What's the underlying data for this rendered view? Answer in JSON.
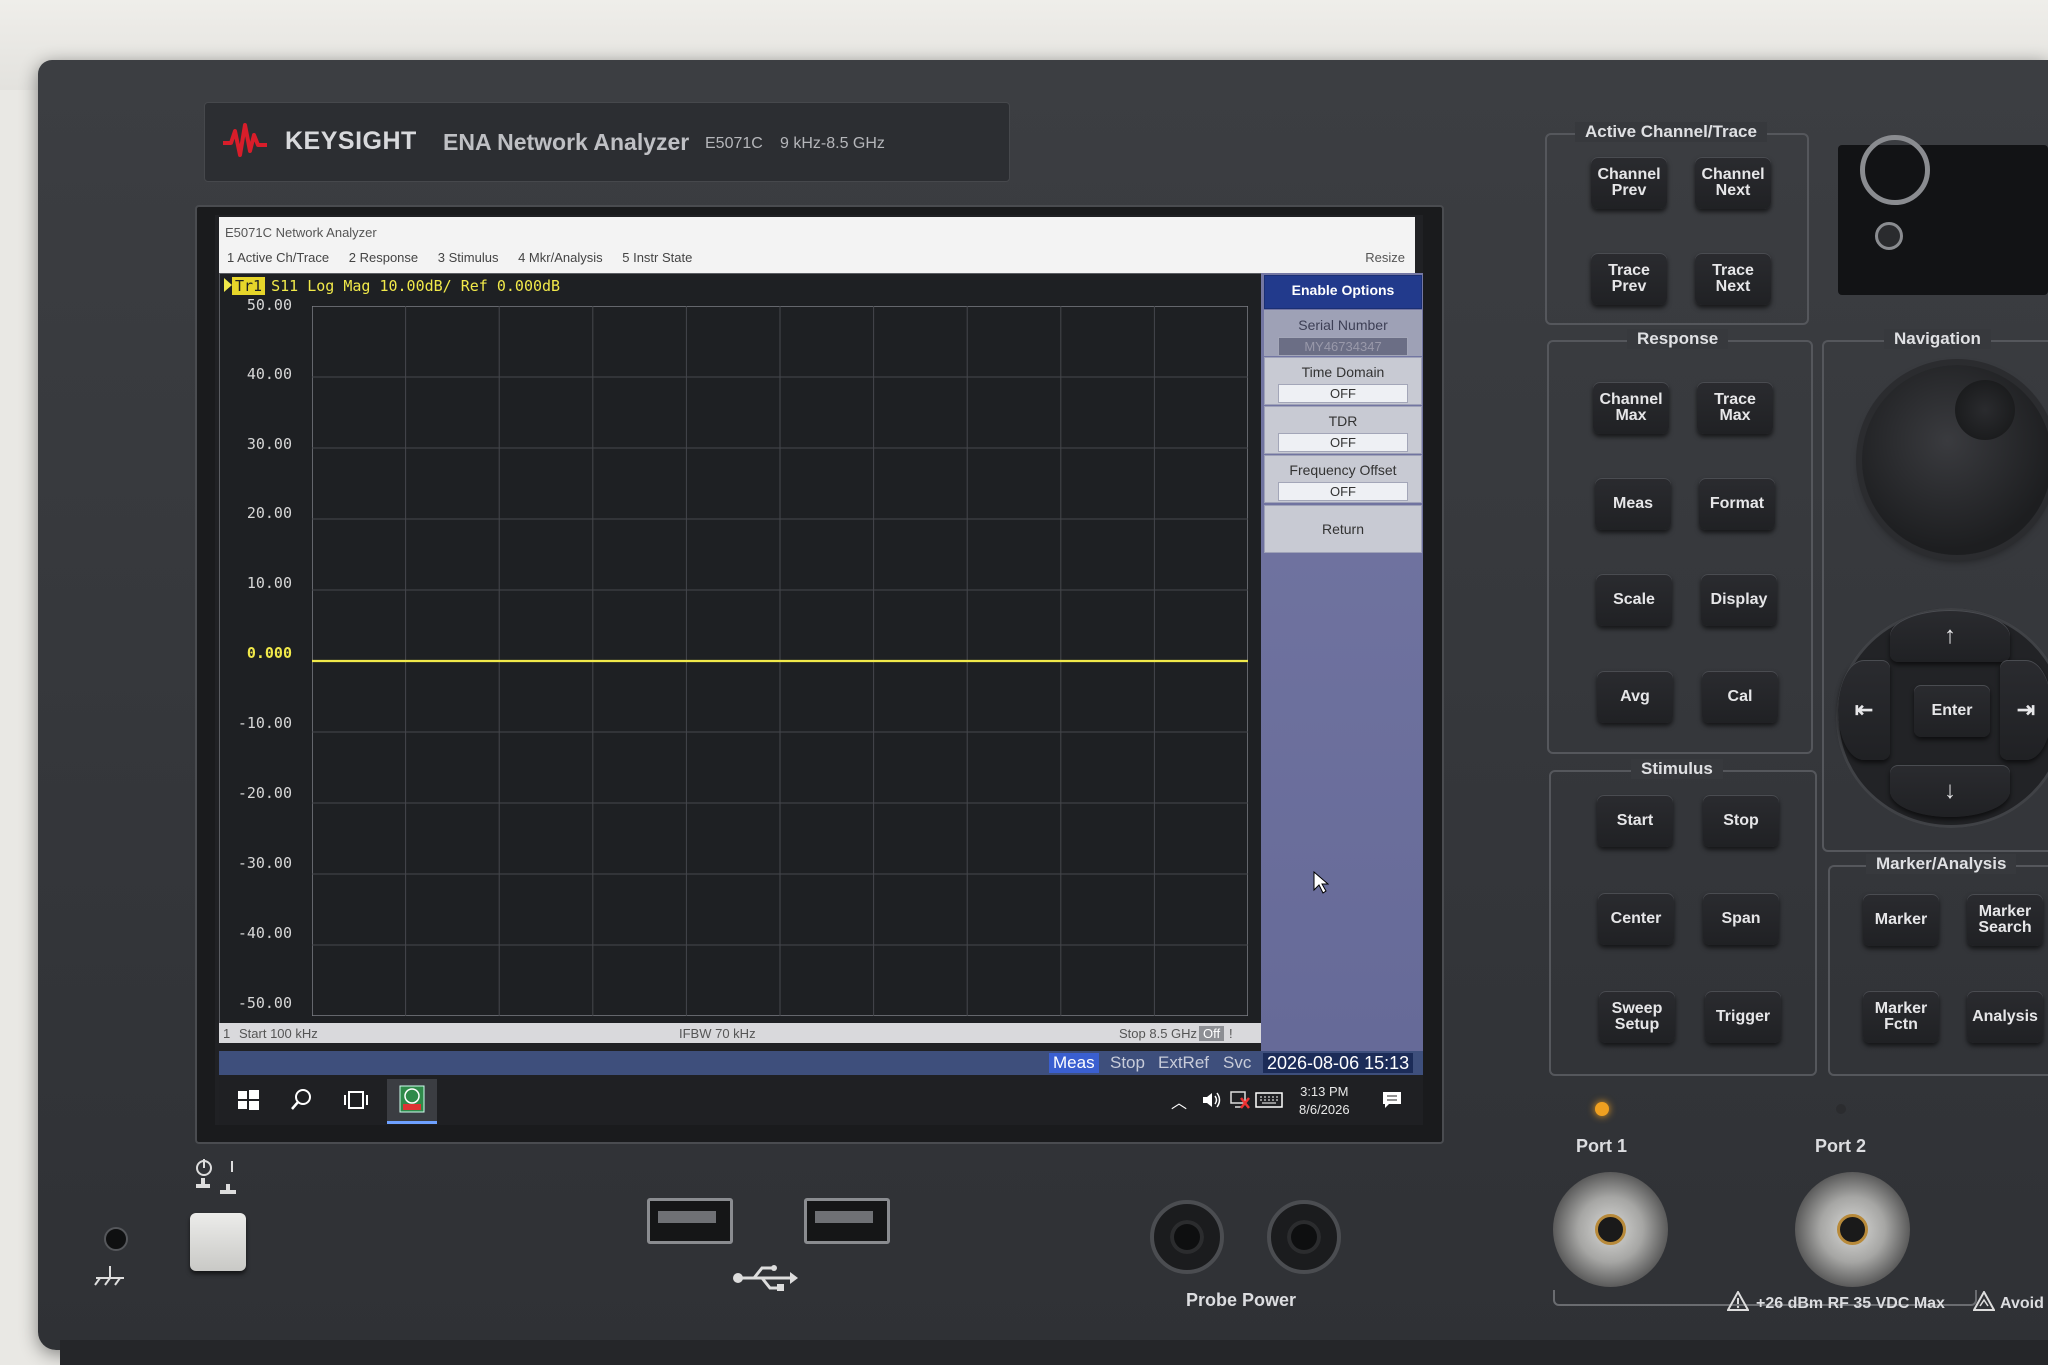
{
  "brand": {
    "name": "KEYSIGHT",
    "model": "ENA Network Analyzer",
    "part_number": "E5071C",
    "freq_range": "9 kHz-8.5 GHz"
  },
  "window": {
    "title": "E5071C Network Analyzer",
    "resize_label": "Resize",
    "menu": [
      "1 Active Ch/Trace",
      "2 Response",
      "3 Stimulus",
      "4 Mkr/Analysis",
      "5 Instr State"
    ]
  },
  "trace": {
    "badge": "Tr1",
    "header": "S11 Log Mag 10.00dB/ Ref 0.000dB",
    "y_labels": [
      "50.00",
      "40.00",
      "30.00",
      "20.00",
      "10.00",
      "0.000",
      "-10.00",
      "-20.00",
      "-30.00",
      "-40.00",
      "-50.00"
    ],
    "ref_value": 0,
    "y_range": [
      -50,
      50
    ],
    "trace_color": "#f1e94a"
  },
  "chart_data": {
    "type": "line",
    "title": "S11 Log Mag 10.00dB/ Ref 0.000dB",
    "xlabel": "",
    "ylabel": "",
    "ylim": [
      -50,
      50
    ],
    "x_start": "Start 100 kHz",
    "x_stop": "Stop 8.5 GHz",
    "series": [
      {
        "name": "Tr1",
        "values": [
          0,
          0
        ]
      }
    ],
    "grid": true
  },
  "channel_status": {
    "channel": "1",
    "start": "Start 100 kHz",
    "ifbw": "IFBW 70 kHz",
    "stop": "Stop 8.5 GHz",
    "off_badge": "Off",
    "exclam": "!"
  },
  "softkeys": {
    "enable_options": "Enable Options",
    "serial_label": "Serial Number",
    "serial_value": "MY46734347",
    "time_domain_label": "Time Domain",
    "time_domain_value": "OFF",
    "tdr_label": "TDR",
    "tdr_value": "OFF",
    "freq_offset_label": "Frequency Offset",
    "freq_offset_value": "OFF",
    "return_label": "Return"
  },
  "status_bar": {
    "meas": "Meas",
    "stop": "Stop",
    "extref": "ExtRef",
    "svc": "Svc",
    "datetime": "2026-08-06 15:13"
  },
  "taskbar": {
    "time": "3:13 PM",
    "date": "8/6/2026"
  },
  "panel": {
    "active_channel": {
      "title": "Active Channel/Trace",
      "buttons": [
        "Channel\nPrev",
        "Channel\nNext",
        "Trace\nPrev",
        "Trace\nNext"
      ]
    },
    "response": {
      "title": "Response",
      "buttons": [
        "Channel\nMax",
        "Trace\nMax",
        "Meas",
        "Format",
        "Scale",
        "Display",
        "Avg",
        "Cal"
      ]
    },
    "navigation": {
      "title": "Navigation",
      "enter": "Enter"
    },
    "stimulus": {
      "title": "Stimulus",
      "buttons": [
        "Start",
        "Stop",
        "Center",
        "Span",
        "Sweep\nSetup",
        "Trigger"
      ]
    },
    "marker_analysis": {
      "title": "Marker/Analysis",
      "buttons": [
        "Marker",
        "Marker\nSearch",
        "Marker\nFctn",
        "Analysis"
      ]
    },
    "port1": "Port 1",
    "port2": "Port 2",
    "probe_power": "Probe Power",
    "warning": "+26 dBm RF  35 VDC Max",
    "warning_tail": "Avoid"
  },
  "colors": {
    "trace": "#f1e94a",
    "softkey_primary": "#223a8c",
    "statusbar": "#3e4f7c",
    "port_led": "#f0a020"
  }
}
